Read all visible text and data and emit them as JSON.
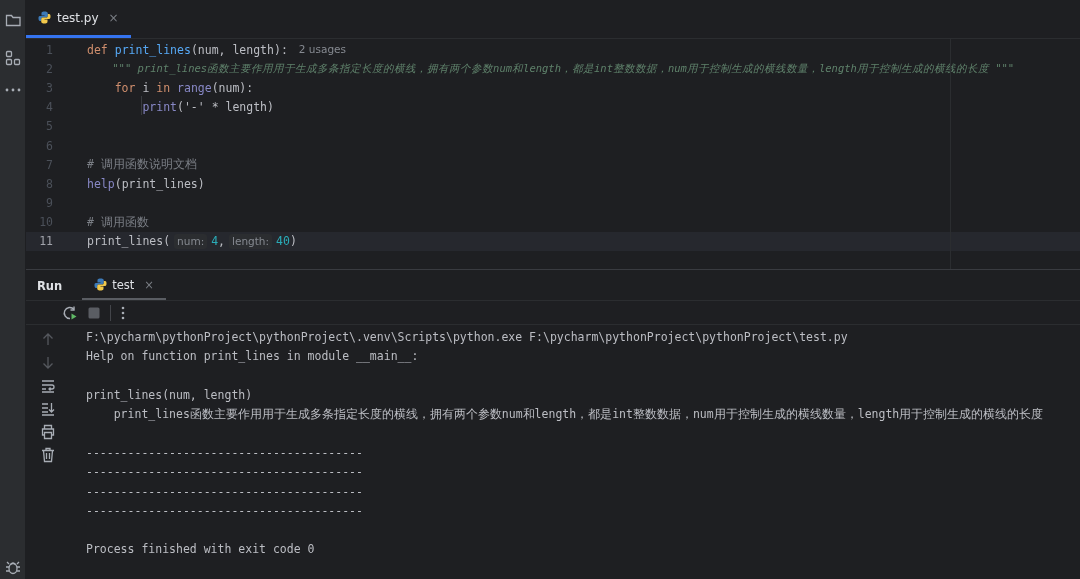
{
  "editor_tab": {
    "label": "test.py",
    "selected": true,
    "close": "×"
  },
  "editor": {
    "lines": [
      {
        "number": "1",
        "current": false,
        "tokens": [
          {
            "kind": "keyword",
            "text": "def "
          },
          {
            "kind": "function",
            "text": "print_lines"
          },
          {
            "kind": "plain",
            "text": "(num, length):"
          },
          {
            "kind": "hint",
            "text": "2 usages"
          }
        ]
      },
      {
        "number": "2",
        "current": false,
        "tokens": [
          {
            "kind": "docstring",
            "text": "    \"\"\" print_lines函数主要作用用于生成多条指定长度的横线，拥有两个参数num和length，都是int整数数据，num用于控制生成的横线数量，length用于控制生成的横线的长度 \"\"\""
          }
        ]
      },
      {
        "number": "3",
        "current": false,
        "tokens": [
          {
            "kind": "keyword",
            "text": "    for "
          },
          {
            "kind": "plain",
            "text": "i "
          },
          {
            "kind": "keyword",
            "text": "in "
          },
          {
            "kind": "builtin",
            "text": "range"
          },
          {
            "kind": "plain",
            "text": "(num):"
          }
        ]
      },
      {
        "number": "4",
        "current": false,
        "tokens": [
          {
            "kind": "builtin",
            "text": "        print"
          },
          {
            "kind": "plain",
            "text": "('-' * length)"
          }
        ]
      },
      {
        "number": "5",
        "current": false
      },
      {
        "number": "6",
        "current": false
      },
      {
        "number": "7",
        "current": false,
        "tokens": [
          {
            "kind": "comment",
            "text": "# 调用函数说明文档"
          }
        ]
      },
      {
        "number": "8",
        "current": false,
        "tokens": [
          {
            "kind": "builtin",
            "text": "help"
          },
          {
            "kind": "plain",
            "text": "(print_lines)"
          }
        ]
      },
      {
        "number": "9",
        "current": false
      },
      {
        "number": "10",
        "current": false,
        "tokens": [
          {
            "kind": "comment",
            "text": "# 调用函数"
          }
        ]
      },
      {
        "number": "11",
        "current": true,
        "tokens": [
          {
            "kind": "plain",
            "text": "print_lines("
          },
          {
            "kind": "hint",
            "text": "num:"
          },
          {
            "kind": "number",
            "text": "4"
          },
          {
            "kind": "plain",
            "text": ","
          },
          {
            "kind": "hint",
            "text": "length:"
          },
          {
            "kind": "number",
            "text": "40"
          },
          {
            "kind": "plain",
            "text": ")"
          }
        ]
      }
    ]
  },
  "run_panel": {
    "title": "Run",
    "tabs": [
      {
        "label": "test",
        "selected": true,
        "close": "×"
      }
    ],
    "console": [
      {
        "lines": [
          "F:\\pycharm\\pythonProject\\pythonProject\\.venv\\Scripts\\python.exe F:\\pycharm\\pythonProject\\pythonProject\\test.py",
          "Help on function print_lines in module __main__:"
        ]
      },
      {
        "lines": [
          "print_lines(num, length)",
          "    print_lines函数主要作用用于生成多条指定长度的横线，拥有两个参数num和length，都是int整数数据，num用于控制生成的横线数量，length用于控制生成的横线的长度"
        ]
      },
      {
        "lines": [
          "----------------------------------------",
          "----------------------------------------",
          "----------------------------------------",
          "----------------------------------------"
        ]
      },
      {
        "lines": [
          "Process finished with exit code 0"
        ]
      }
    ]
  }
}
